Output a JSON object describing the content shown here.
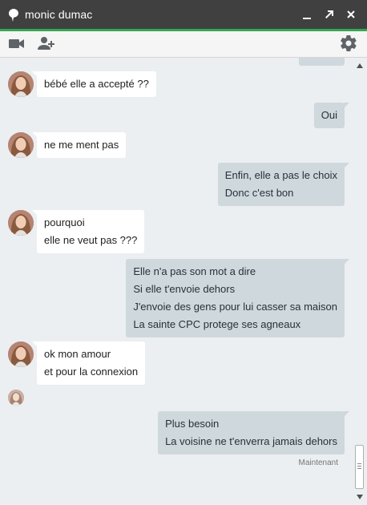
{
  "header": {
    "title": "monic dumac",
    "accent_color": "#34a853",
    "bar_color": "#404040",
    "icons": [
      "chat-bubble-icon",
      "minimize-icon",
      "popout-icon",
      "close-icon"
    ]
  },
  "toolbar": {
    "icons": [
      "video-camera-icon",
      "add-person-icon",
      "gear-icon"
    ]
  },
  "messages": [
    {
      "direction": "in",
      "lines": [
        "bébé elle a accepté ??"
      ]
    },
    {
      "direction": "out",
      "lines": [
        "Oui"
      ]
    },
    {
      "direction": "in",
      "lines": [
        "ne me ment pas"
      ]
    },
    {
      "direction": "out",
      "lines": [
        "Enfin, elle a pas le choix",
        "Donc c'est bon"
      ]
    },
    {
      "direction": "in",
      "lines": [
        "pourquoi",
        "elle ne veut pas ???"
      ]
    },
    {
      "direction": "out",
      "lines": [
        "Elle n'a pas son mot a dire",
        "Si elle t'envoie dehors",
        "J'envoie des gens pour lui casser sa maison",
        "La sainte CPC protege ses agneaux"
      ]
    },
    {
      "direction": "in",
      "lines": [
        "ok mon amour",
        "et pour la connexion"
      ]
    },
    {
      "direction": "out",
      "lines": [
        "Plus besoin",
        "La voisine ne t'enverra jamais dehors"
      ]
    }
  ],
  "timestamp": "Maintenant",
  "colors": {
    "incoming_bubble": "#ffffff",
    "outgoing_bubble": "#cfd8dc",
    "background": "#eceff1"
  }
}
